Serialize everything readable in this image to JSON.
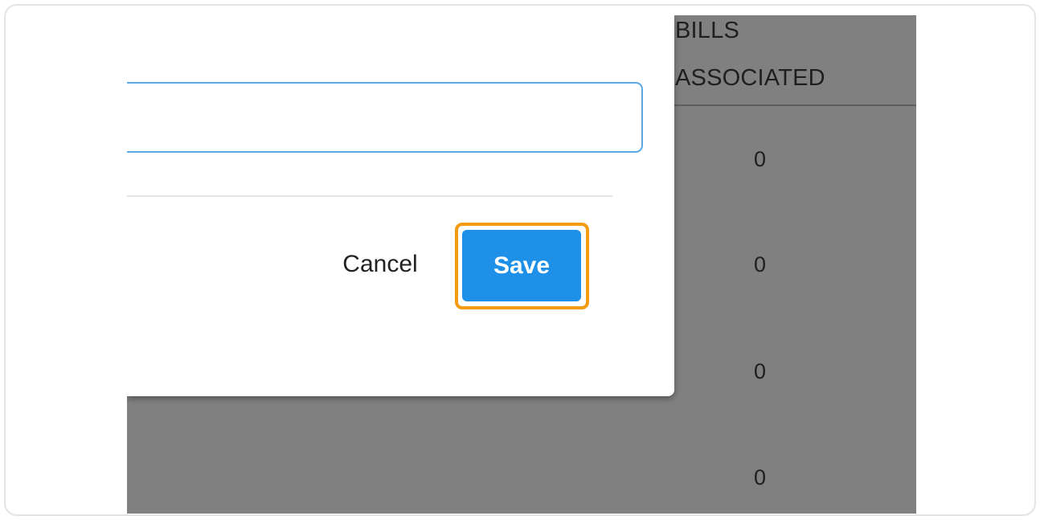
{
  "table": {
    "column_header": "BILLS\nASSOCIATED",
    "rows": [
      {
        "bills_associated": "0"
      },
      {
        "bills_associated": "0"
      },
      {
        "bills_associated": "0"
      },
      {
        "bills_associated": "0"
      }
    ]
  },
  "dialog": {
    "input": {
      "value": "",
      "placeholder": ""
    },
    "cancel_label": "Cancel",
    "save_label": "Save"
  },
  "colors": {
    "overlay": "#808080",
    "primary_button": "#1e90e8",
    "highlight": "#f39c12",
    "input_border": "#5aa9e6"
  }
}
